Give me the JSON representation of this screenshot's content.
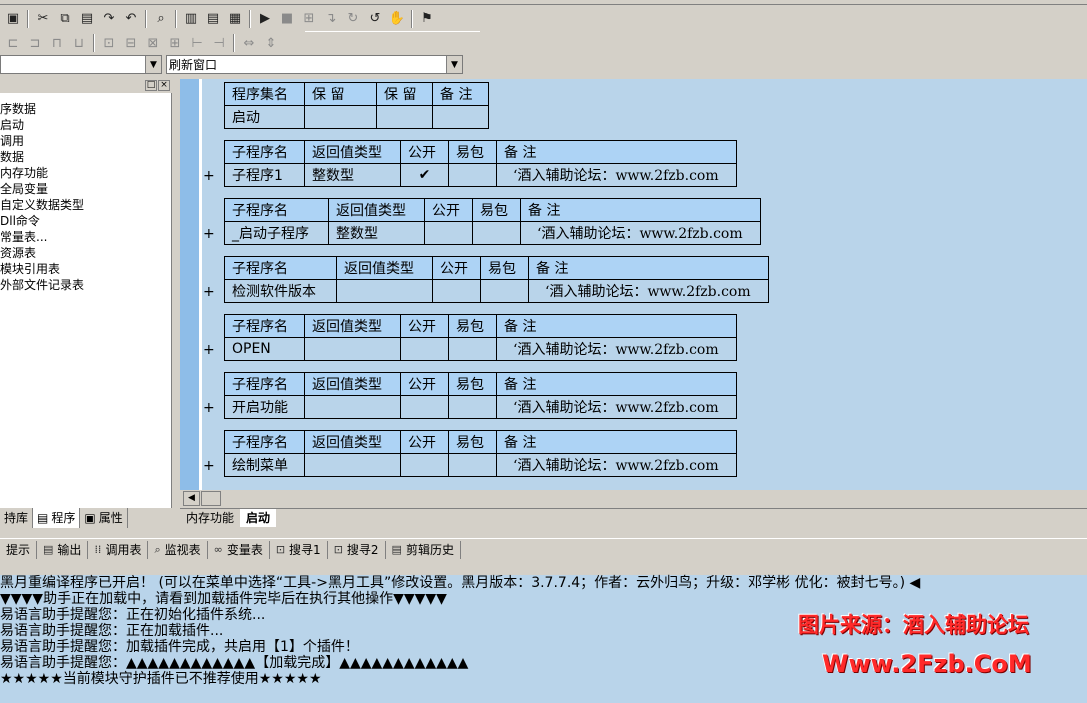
{
  "toolbar1": {
    "icons": [
      "save-icon",
      "cut-icon",
      "copy-icon",
      "paste-icon",
      "redo-icon",
      "undo-icon",
      "find-icon",
      "layout1-icon",
      "layout2-icon",
      "layout3-icon",
      "run-icon",
      "stop-icon",
      "step-icon",
      "step-into-icon",
      "step-over-icon",
      "step-out-icon",
      "hand-icon",
      "compile-icon"
    ]
  },
  "toolbar2": {
    "icons": [
      "align-left-icon",
      "align-center-icon",
      "align-right-icon",
      "align-top-icon",
      "align-mid-icon",
      "align-bottom-icon",
      "same-width-icon",
      "same-height-icon",
      "same-size-icon",
      "hspace-icon",
      "vspace-icon",
      "center-icon"
    ]
  },
  "combo_left": {
    "value": ""
  },
  "combo_right": {
    "value": "刷新窗口"
  },
  "left_panel": {
    "tree": [
      "序数据",
      "启动",
      "调用",
      "数据",
      "内存功能",
      "全局变量",
      "自定义数据类型",
      "Dll命令",
      "常量表...",
      "资源表",
      "模块引用表",
      "外部文件记录表"
    ],
    "tabs": [
      "持库",
      "程序",
      "属性"
    ]
  },
  "editor": {
    "header_table": {
      "headers": [
        "程序集名",
        "保 留",
        "保 留",
        "备 注"
      ],
      "row": [
        "启动",
        "",
        "",
        ""
      ]
    },
    "subs": [
      {
        "headers": [
          "子程序名",
          "返回值类型",
          "公开",
          "易包",
          "备 注"
        ],
        "name": "子程序1",
        "ret": "整数型",
        "public": "✔",
        "pkg": "",
        "comment": "‘酒入辅助论坛：www.2fzb.com"
      },
      {
        "headers": [
          "子程序名",
          "返回值类型",
          "公开",
          "易包",
          "备 注"
        ],
        "name": "_启动子程序",
        "ret": "整数型",
        "public": "",
        "pkg": "",
        "comment": "‘酒入辅助论坛：www.2fzb.com"
      },
      {
        "headers": [
          "子程序名",
          "返回值类型",
          "公开",
          "易包",
          "备 注"
        ],
        "name": "检测软件版本",
        "ret": "",
        "public": "",
        "pkg": "",
        "comment": "‘酒入辅助论坛：www.2fzb.com"
      },
      {
        "headers": [
          "子程序名",
          "返回值类型",
          "公开",
          "易包",
          "备 注"
        ],
        "name": "OPEN",
        "ret": "",
        "public": "",
        "pkg": "",
        "comment": "‘酒入辅助论坛：www.2fzb.com"
      },
      {
        "headers": [
          "子程序名",
          "返回值类型",
          "公开",
          "易包",
          "备 注"
        ],
        "name": "开启功能",
        "ret": "",
        "public": "",
        "pkg": "",
        "comment": "‘酒入辅助论坛：www.2fzb.com"
      },
      {
        "headers": [
          "子程序名",
          "返回值类型",
          "公开",
          "易包",
          "备 注"
        ],
        "name": "绘制菜单",
        "ret": "",
        "public": "",
        "pkg": "",
        "comment": "‘酒入辅助论坛：www.2fzb.com"
      }
    ],
    "expand_symbol": "+",
    "tabs": [
      "内存功能",
      "启动"
    ]
  },
  "output_tabs": [
    "提示",
    "输出",
    "调用表",
    "监视表",
    "变量表",
    "搜寻1",
    "搜寻2",
    "剪辑历史"
  ],
  "output_lines": [
    "黑月重编译程序已开启！  (可以在菜单中选择“工具->黑月工具”修改设置。黑月版本：3.7.7.4；作者：云外归鸟；升级：邓学彬 优化：被封七号。) ◀",
    "▼▼▼▼助手正在加载中，请看到加载插件完毕后在执行其他操作▼▼▼▼▼",
    "易语言助手提醒您：正在初始化插件系统...",
    "易语言助手提醒您：正在加载插件...",
    "易语言助手提醒您：加载插件完成，共启用【1】个插件！",
    "易语言助手提醒您：▲▲▲▲▲▲▲▲▲▲▲▲【加载完成】▲▲▲▲▲▲▲▲▲▲▲▲",
    "★★★★★当前模块守护插件已不推荐使用★★★★★"
  ],
  "watermark": {
    "line1": "图片来源：酒入辅助论坛",
    "line2": "Www.2Fzb.CoM"
  }
}
